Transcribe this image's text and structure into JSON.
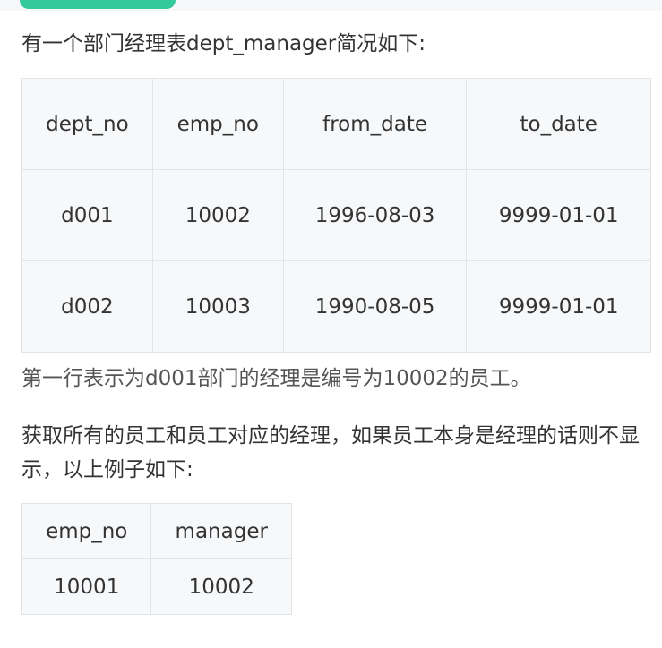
{
  "intro": "有一个部门经理表dept_manager简况如下:",
  "dept_manager": {
    "headers": [
      "dept_no",
      "emp_no",
      "from_date",
      "to_date"
    ],
    "rows": [
      [
        "d001",
        "10002",
        "1996-08-03",
        "9999-01-01"
      ],
      [
        "d002",
        "10003",
        "1990-08-05",
        "9999-01-01"
      ]
    ]
  },
  "note": "第一行表示为d001部门的经理是编号为10002的员工。",
  "task": "获取所有的员工和员工对应的经理，如果员工本身是经理的话则不显示，以上例子如下:",
  "result": {
    "headers": [
      "emp_no",
      "manager"
    ],
    "rows": [
      [
        "10001",
        "10002"
      ]
    ]
  }
}
